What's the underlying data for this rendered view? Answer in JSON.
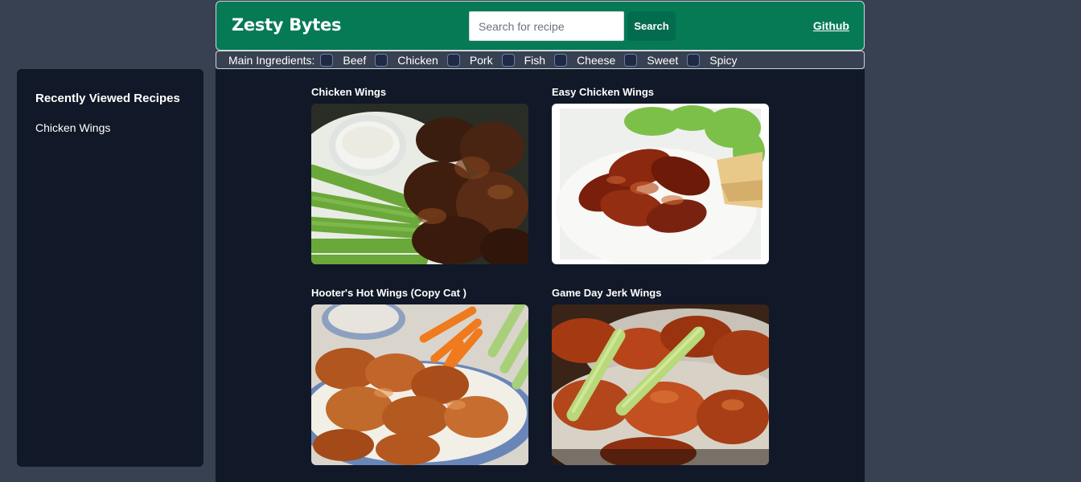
{
  "header": {
    "brand": "Zesty Bytes",
    "search_placeholder": "Search for recipe",
    "search_button": "Search",
    "github_link": "Github"
  },
  "filters": {
    "label": "Main Ingredients:",
    "options": [
      "Beef",
      "Chicken",
      "Pork",
      "Fish",
      "Cheese",
      "Sweet",
      "Spicy"
    ]
  },
  "sidebar": {
    "title": "Recently Viewed Recipes",
    "items": [
      "Chicken Wings"
    ]
  },
  "recipes": [
    {
      "title": "Chicken Wings",
      "image_icon": "wings-celery-dip-photo"
    },
    {
      "title": "Easy Chicken Wings",
      "image_icon": "glazed-wings-plate-photo"
    },
    {
      "title": "Hooter's Hot Wings (Copy Cat )",
      "image_icon": "hot-wings-platter-photo"
    },
    {
      "title": "Game Day Jerk Wings",
      "image_icon": "jerk-wings-celery-photo"
    }
  ],
  "colors": {
    "page_bg": "#374151",
    "panel_bg": "#111827",
    "header_green": "#057a55",
    "button_green": "#046c4e"
  }
}
